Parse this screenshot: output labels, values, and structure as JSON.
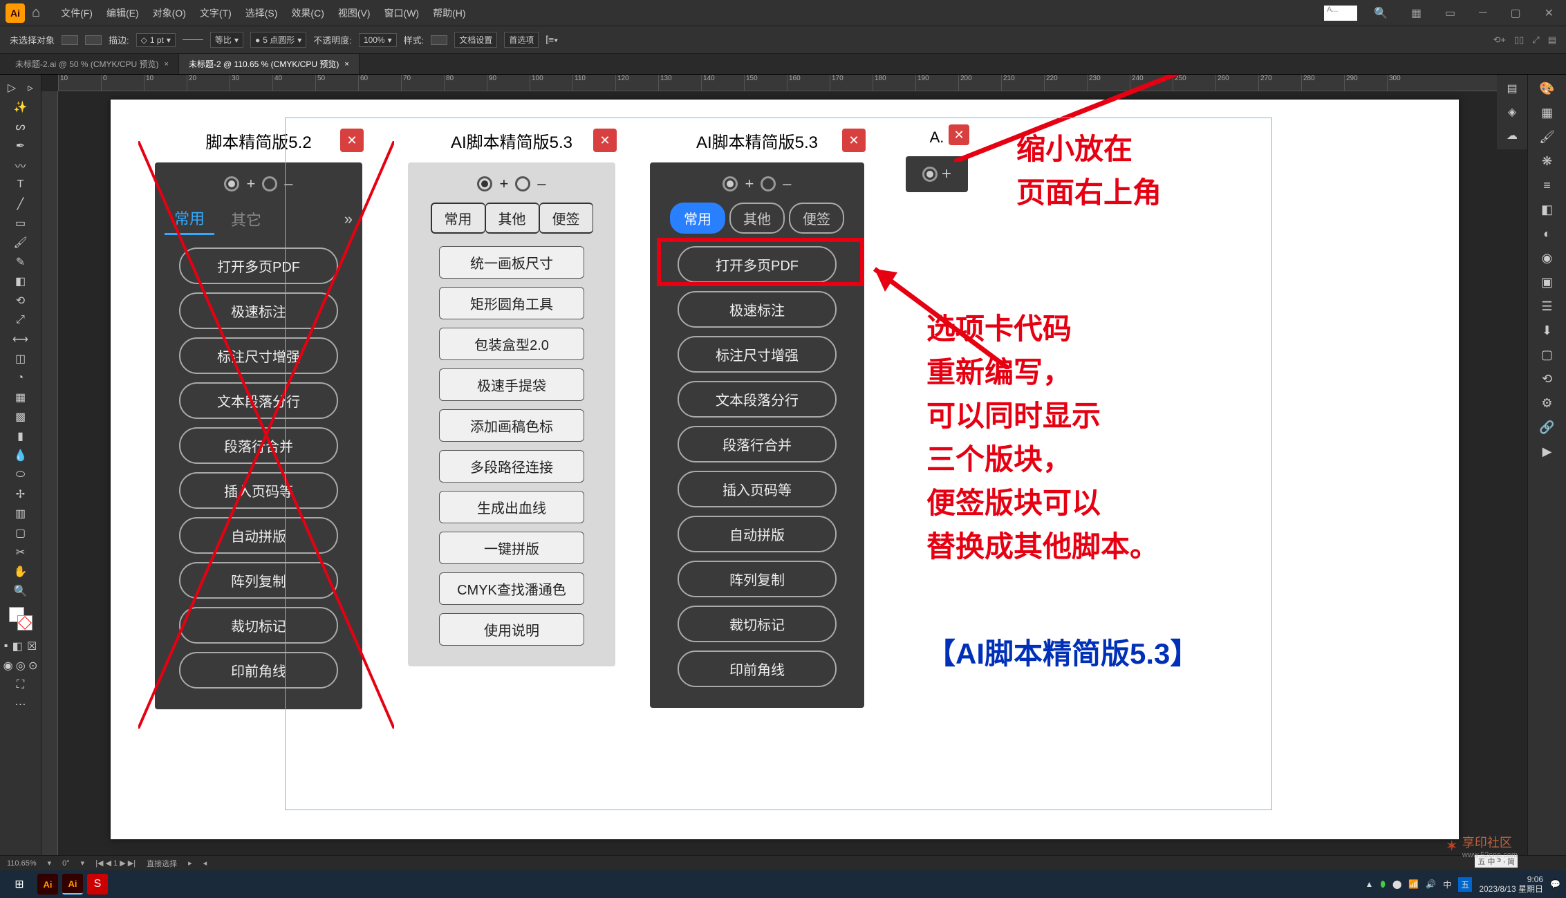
{
  "menubar": {
    "items": [
      "文件(F)",
      "编辑(E)",
      "对象(O)",
      "文字(T)",
      "选择(S)",
      "效果(C)",
      "视图(V)",
      "窗口(W)",
      "帮助(H)"
    ],
    "search_placeholder": "A..."
  },
  "optbar": {
    "noselect": "未选择对象",
    "stroke_label": "描边:",
    "stroke_val": "1 pt",
    "uniform": "等比",
    "brush_val": "5 点圆形",
    "opacity_label": "不透明度:",
    "opacity_val": "100%",
    "style_label": "样式:",
    "docsetup": "文档设置",
    "prefs": "首选项"
  },
  "tabs": [
    {
      "label": "未标题-2.ai @ 50 % (CMYK/CPU 预览)",
      "active": false
    },
    {
      "label": "未标题-2 @ 110.65 % (CMYK/CPU 预览)",
      "active": true
    }
  ],
  "ruler_marks": [
    "10",
    "0",
    "10",
    "20",
    "30",
    "40",
    "50",
    "60",
    "70",
    "80",
    "90",
    "100",
    "110",
    "120",
    "130",
    "140",
    "150",
    "160",
    "170",
    "180",
    "190",
    "200",
    "210",
    "220",
    "230",
    "240",
    "250",
    "260",
    "270",
    "280",
    "290",
    "300"
  ],
  "panel52": {
    "title": "脚本精简版5.2",
    "tabs": [
      "常用",
      "其它"
    ],
    "btns": [
      "打开多页PDF",
      "极速标注",
      "标注尺寸增强",
      "文本段落分行",
      "段落行合并",
      "插入页码等",
      "自动拼版",
      "阵列复制",
      "裁切标记",
      "印前角线"
    ]
  },
  "panel53light": {
    "title": "AI脚本精简版5.3",
    "tabs": [
      "常用",
      "其他",
      "便签"
    ],
    "btns": [
      "统一画板尺寸",
      "矩形圆角工具",
      "包装盒型2.0",
      "极速手提袋",
      "添加画稿色标",
      "多段路径连接",
      "生成出血线",
      "一键拼版",
      "CMYK查找潘通色",
      "使用说明"
    ]
  },
  "panel53dark": {
    "title": "AI脚本精简版5.3",
    "tabs": [
      "常用",
      "其他",
      "便签"
    ],
    "btns": [
      "打开多页PDF",
      "极速标注",
      "标注尺寸增强",
      "文本段落分行",
      "段落行合并",
      "插入页码等",
      "自动拼版",
      "阵列复制",
      "裁切标记",
      "印前角线"
    ]
  },
  "mini": {
    "title": "A."
  },
  "anno1": "缩小放在\n页面右上角",
  "anno2": "选项卡代码\n重新编写，\n可以同时显示\n三个版块，\n便签版块可以\n替换成其他脚本。",
  "anno3": "【AI脚本精简版5.3】",
  "status": {
    "zoom": "110.65%",
    "rot": "0°",
    "nav": "1",
    "tool": "直接选择"
  },
  "taskbar": {
    "time": "9:06",
    "date": "2023/8/13 星期日"
  },
  "ime": [
    "五",
    "中",
    "э",
    ",",
    "简"
  ],
  "watermark": "享印社区",
  "watermark_url": "www.52cnp.com"
}
